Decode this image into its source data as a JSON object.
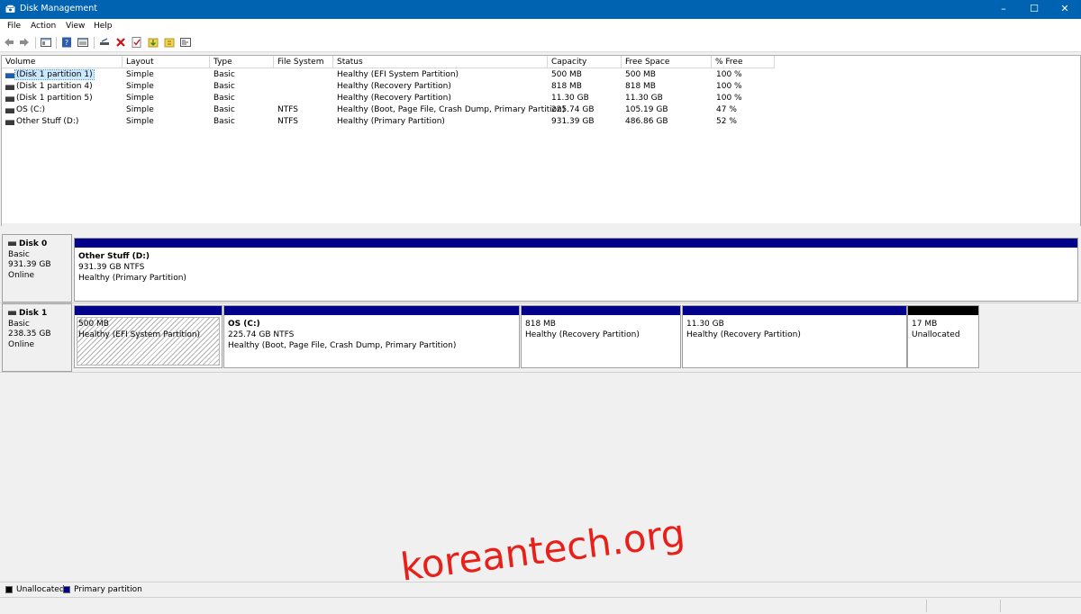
{
  "window": {
    "title": "Disk Management"
  },
  "menu": [
    "File",
    "Action",
    "View",
    "Help"
  ],
  "toolbar": {
    "icons": [
      "back-arrow-icon",
      "forward-arrow-icon",
      "console-tree-icon",
      "help-icon",
      "properties-icon",
      "connect-icon",
      "delete-icon",
      "check-icon",
      "import-icon",
      "rescan-icon",
      "settings-icon"
    ]
  },
  "volume_table": {
    "columns": [
      "Volume",
      "Layout",
      "Type",
      "File System",
      "Status",
      "Capacity",
      "Free Space",
      "% Free"
    ],
    "rows": [
      [
        "(Disk 1 partition 1)",
        "Simple",
        "Basic",
        "",
        "Healthy (EFI System Partition)",
        "500 MB",
        "500 MB",
        "100 %"
      ],
      [
        "(Disk 1 partition 4)",
        "Simple",
        "Basic",
        "",
        "Healthy (Recovery Partition)",
        "818 MB",
        "818 MB",
        "100 %"
      ],
      [
        "(Disk 1 partition 5)",
        "Simple",
        "Basic",
        "",
        "Healthy (Recovery Partition)",
        "11.30 GB",
        "11.30 GB",
        "100 %"
      ],
      [
        "OS (C:)",
        "Simple",
        "Basic",
        "NTFS",
        "Healthy (Boot, Page File, Crash Dump, Primary Partition)",
        "225.74 GB",
        "105.19 GB",
        "47 %"
      ],
      [
        "Other Stuff (D:)",
        "Simple",
        "Basic",
        "NTFS",
        "Healthy (Primary Partition)",
        "931.39 GB",
        "486.86 GB",
        "52 %"
      ]
    ]
  },
  "disks": [
    {
      "name": "Disk 0",
      "type": "Basic",
      "size": "931.39 GB",
      "state": "Online",
      "partitions": [
        {
          "name": "Other Stuff  (D:)",
          "size": "931.39 GB NTFS",
          "status": "Healthy (Primary Partition)"
        }
      ]
    },
    {
      "name": "Disk 1",
      "type": "Basic",
      "size": "238.35 GB",
      "state": "Online",
      "partitions": [
        {
          "name": "",
          "size": "500 MB",
          "status": "Healthy (EFI System Partition)"
        },
        {
          "name": "OS  (C:)",
          "size": "225.74 GB NTFS",
          "status": "Healthy (Boot, Page File, Crash Dump, Primary Partition)"
        },
        {
          "name": "",
          "size": "818 MB",
          "status": "Healthy (Recovery Partition)"
        },
        {
          "name": "",
          "size": "11.30 GB",
          "status": "Healthy (Recovery Partition)"
        },
        {
          "name": "",
          "size": "17 MB",
          "status": "Unallocated"
        }
      ]
    }
  ],
  "legend": [
    {
      "label": "Unallocated",
      "color": "#000000"
    },
    {
      "label": "Primary partition",
      "color": "#00008b"
    }
  ],
  "watermark": "koreantech.org"
}
